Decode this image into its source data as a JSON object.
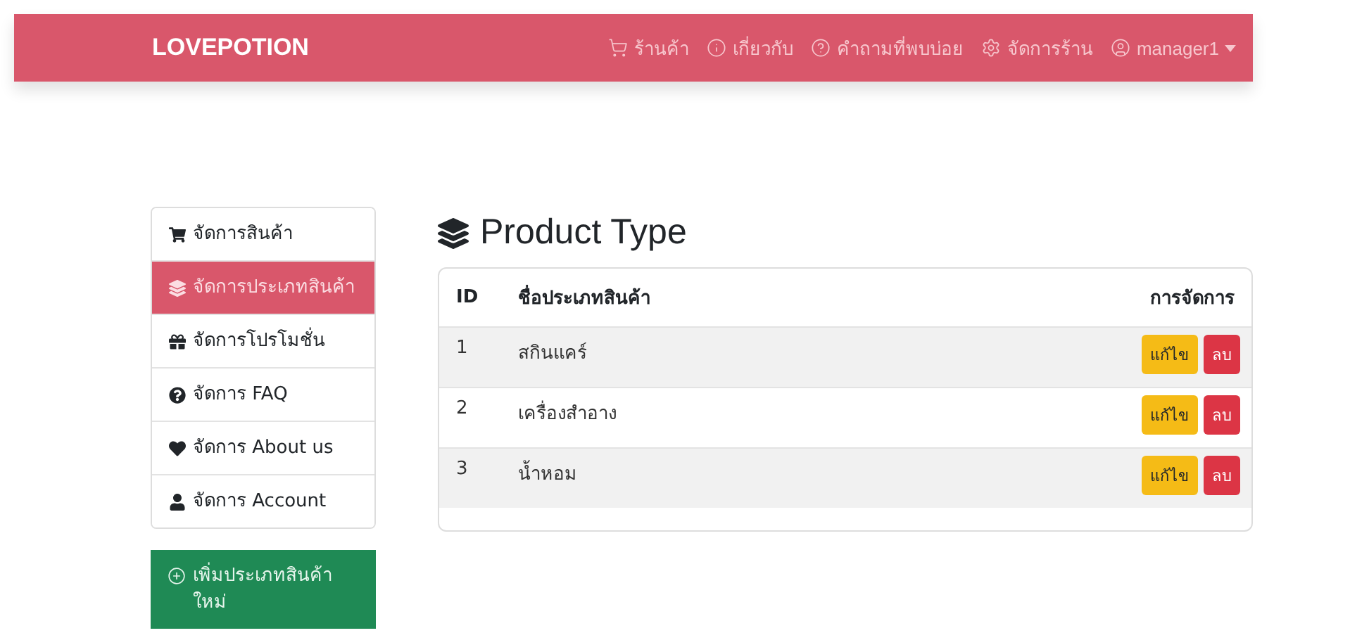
{
  "navbar": {
    "brand": "LOVEPOTION",
    "links": [
      {
        "label": "ร้านค้า"
      },
      {
        "label": "เกี่ยวกับ"
      },
      {
        "label": "คำถามที่พบบ่อย"
      },
      {
        "label": "จัดการร้าน"
      },
      {
        "label": "manager1",
        "dropdown": true
      }
    ]
  },
  "sidebar": {
    "items": [
      {
        "label": "จัดการสินค้า",
        "selected": false
      },
      {
        "label": "จัดการประเภทสินค้า",
        "selected": true
      },
      {
        "label": "จัดการโปรโมชั่น",
        "selected": false
      },
      {
        "label": "จัดการ FAQ",
        "selected": false
      },
      {
        "label": "จัดการ About us",
        "selected": false
      },
      {
        "label": "จัดการ Account",
        "selected": false
      }
    ],
    "add_button": "เพิ่มประเภทสินค้าใหม่"
  },
  "title": "Product Type",
  "table": {
    "columns": [
      "ID",
      "ชื่อประเภทสินค้า",
      "การจัดการ"
    ],
    "rows": [
      {
        "id": "1",
        "name": "สกินแคร์",
        "edit": "แก้ไข",
        "delete": "ลบ"
      },
      {
        "id": "2",
        "name": "เครื่องสำอาง",
        "edit": "แก้ไข",
        "delete": "ลบ"
      },
      {
        "id": "3",
        "name": "น้ำหอม",
        "edit": "แก้ไข",
        "delete": "ลบ"
      }
    ]
  }
}
